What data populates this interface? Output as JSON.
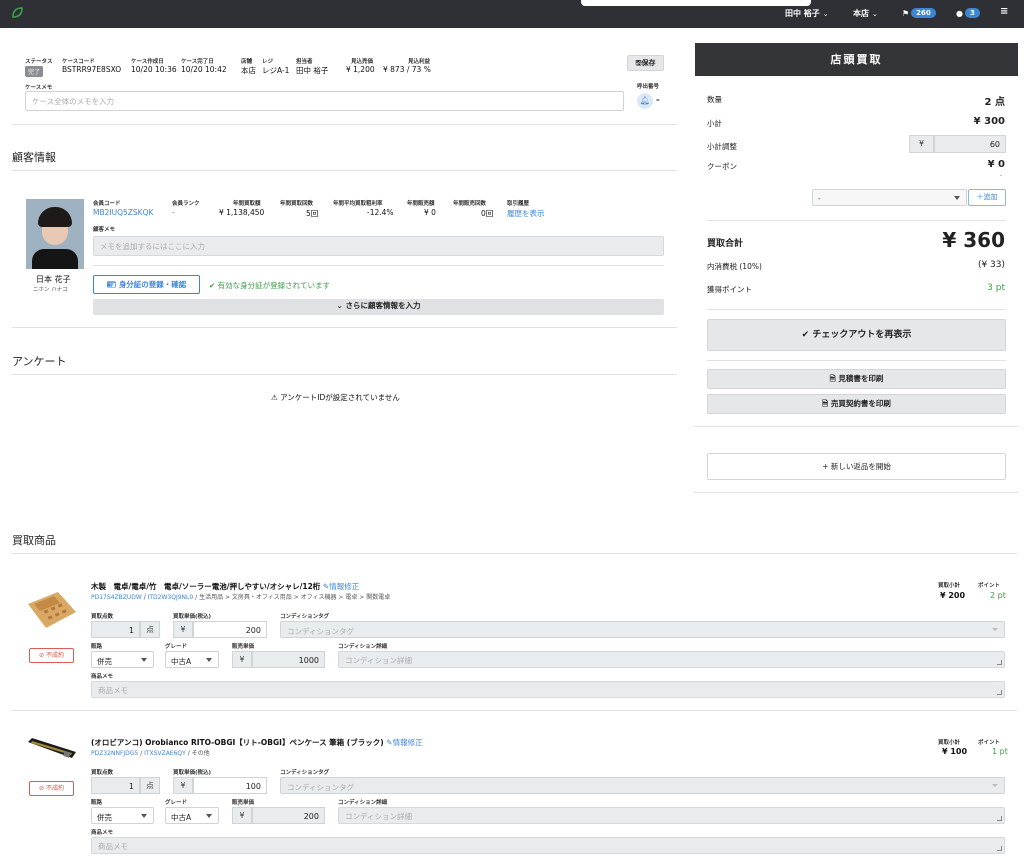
{
  "topbar": {
    "user": "田中 裕子",
    "store": "本店",
    "flag_count": "260",
    "chat_count": "3",
    "menu_icon": "≡"
  },
  "case": {
    "status_label": "ステータス",
    "status_value": "完了",
    "code_label": "ケースコード",
    "code_value": "BSTRR97E8SXO",
    "created_label": "ケース作成日",
    "created_value": "10/20 10:36",
    "done_label": "ケース完了日",
    "done_value": "10/20 10:42",
    "store_label": "店舗",
    "store_value": "本店",
    "register_label": "レジ",
    "register_value": "レジA-1",
    "staff_label": "担当者",
    "staff_value": "田中 裕子",
    "est_sales_label": "見込売価",
    "est_sales_value": "¥ 1,200",
    "est_profit_label": "見込利益",
    "est_profit_value": "¥ 873 / 73 %",
    "save_label": "保存",
    "memo_label": "ケースメモ",
    "memo_placeholder": "ケース全体のメモを入力",
    "call_number_label": "呼出番号",
    "call_number_value": "–"
  },
  "customer": {
    "section_title": "顧客情報",
    "name": "日本 花子",
    "kana": "ニホン ハナコ",
    "member_code_label": "会員コード",
    "member_code_value": "MB2IUQ5ZSKQK",
    "rank_label": "会員ランク",
    "rank_value": "-",
    "annual_buy_amount_label": "年間買取額",
    "annual_buy_amount_value": "¥ 1,138,450",
    "annual_buy_count_label": "年間買取回数",
    "annual_buy_count_value": "5回",
    "annual_margin_label": "年間平均買取粗利率",
    "annual_margin_value": "-12.4%",
    "annual_sales_amount_label": "年間販売額",
    "annual_sales_amount_value": "¥ 0",
    "annual_sales_count_label": "年間販売回数",
    "annual_sales_count_value": "0回",
    "history_label": "取引履歴",
    "history_link": "履歴を表示",
    "memo_label": "顧客メモ",
    "memo_placeholder": "メモを追加するにはここに入力",
    "id_button": "身分証の登録・確認",
    "id_status": "有効な身分証が登録されています",
    "more_button": "さらに顧客情報を入力"
  },
  "survey": {
    "section_title": "アンケート",
    "message": "アンケートIDが設定されていません"
  },
  "items_section": {
    "title": "買取商品",
    "qty_label": "買取点数",
    "unit_price_label": "買取単価(税込)",
    "condition_tag_label": "コンディションタグ",
    "channel_label": "販路",
    "grade_label": "グレード",
    "sale_price_label": "販売単価",
    "condition_detail_label": "コンディション詳細",
    "memo_label": "商品メモ",
    "subtotal_label": "買取小計",
    "points_label": "ポイント",
    "edit_label": "情報修正",
    "unsold_label": "不成約",
    "tag_placeholder": "コンディションタグ",
    "detail_placeholder": "コンディション詳細",
    "memo_placeholder": "商品メモ",
    "yen": "¥",
    "unit": "点"
  },
  "items": [
    {
      "title": "木製　電卓/電卓/竹　電卓/ソーラー電池/押しやすい/オシャレ/12桁",
      "code1": "PD17S4ZBZUDW",
      "code2": "ITD2W3QJ9NL0",
      "category": "生活用品 > 文房具・オフィス用品 > オフィス機器 > 電卓 > 関数電卓",
      "qty": "1",
      "unit_price": "200",
      "channel": "併売",
      "grade": "中古A",
      "sale_price": "1000",
      "subtotal": "¥ 200",
      "points": "2 pt"
    },
    {
      "title": "(オロビアンコ) Orobianco RITO-OBGI【リト-OBGI】ペンケース 筆箱 (ブラック)",
      "code1": "PDZ32NNFJDG5",
      "code2": "ITXSVZAE6QY",
      "category": "その他",
      "qty": "1",
      "unit_price": "100",
      "channel": "併売",
      "grade": "中古A",
      "sale_price": "200",
      "subtotal": "¥ 100",
      "points": "1 pt"
    }
  ],
  "summary": {
    "title": "店頭買取",
    "count_label": "数量",
    "count_value": "2 点",
    "subtotal_label": "小計",
    "subtotal_value": "¥ 300",
    "adjust_label": "小計調整",
    "adjust_value": "60",
    "yen": "¥",
    "coupon_label": "クーポン",
    "coupon_value": "¥ 0",
    "coupon_sub": "-",
    "coupon_select": "-",
    "add_label": "＋追加",
    "total_label": "買取合計",
    "total_value": "¥ 360",
    "tax_label": "内消費税 (10%)",
    "tax_value": "(¥ 33)",
    "points_label": "獲得ポイント",
    "points_value": "3 pt",
    "checkout_button": "チェックアウトを再表示",
    "estimate_button": "見積書を印刷",
    "contract_button": "売買契約書を印刷",
    "return_button": "新しい返品を開始"
  },
  "colors": {
    "topbar": "#2e3035",
    "accent": "#3d86d6",
    "header": "#333538",
    "danger": "#d9534f",
    "success": "#3aa048"
  }
}
